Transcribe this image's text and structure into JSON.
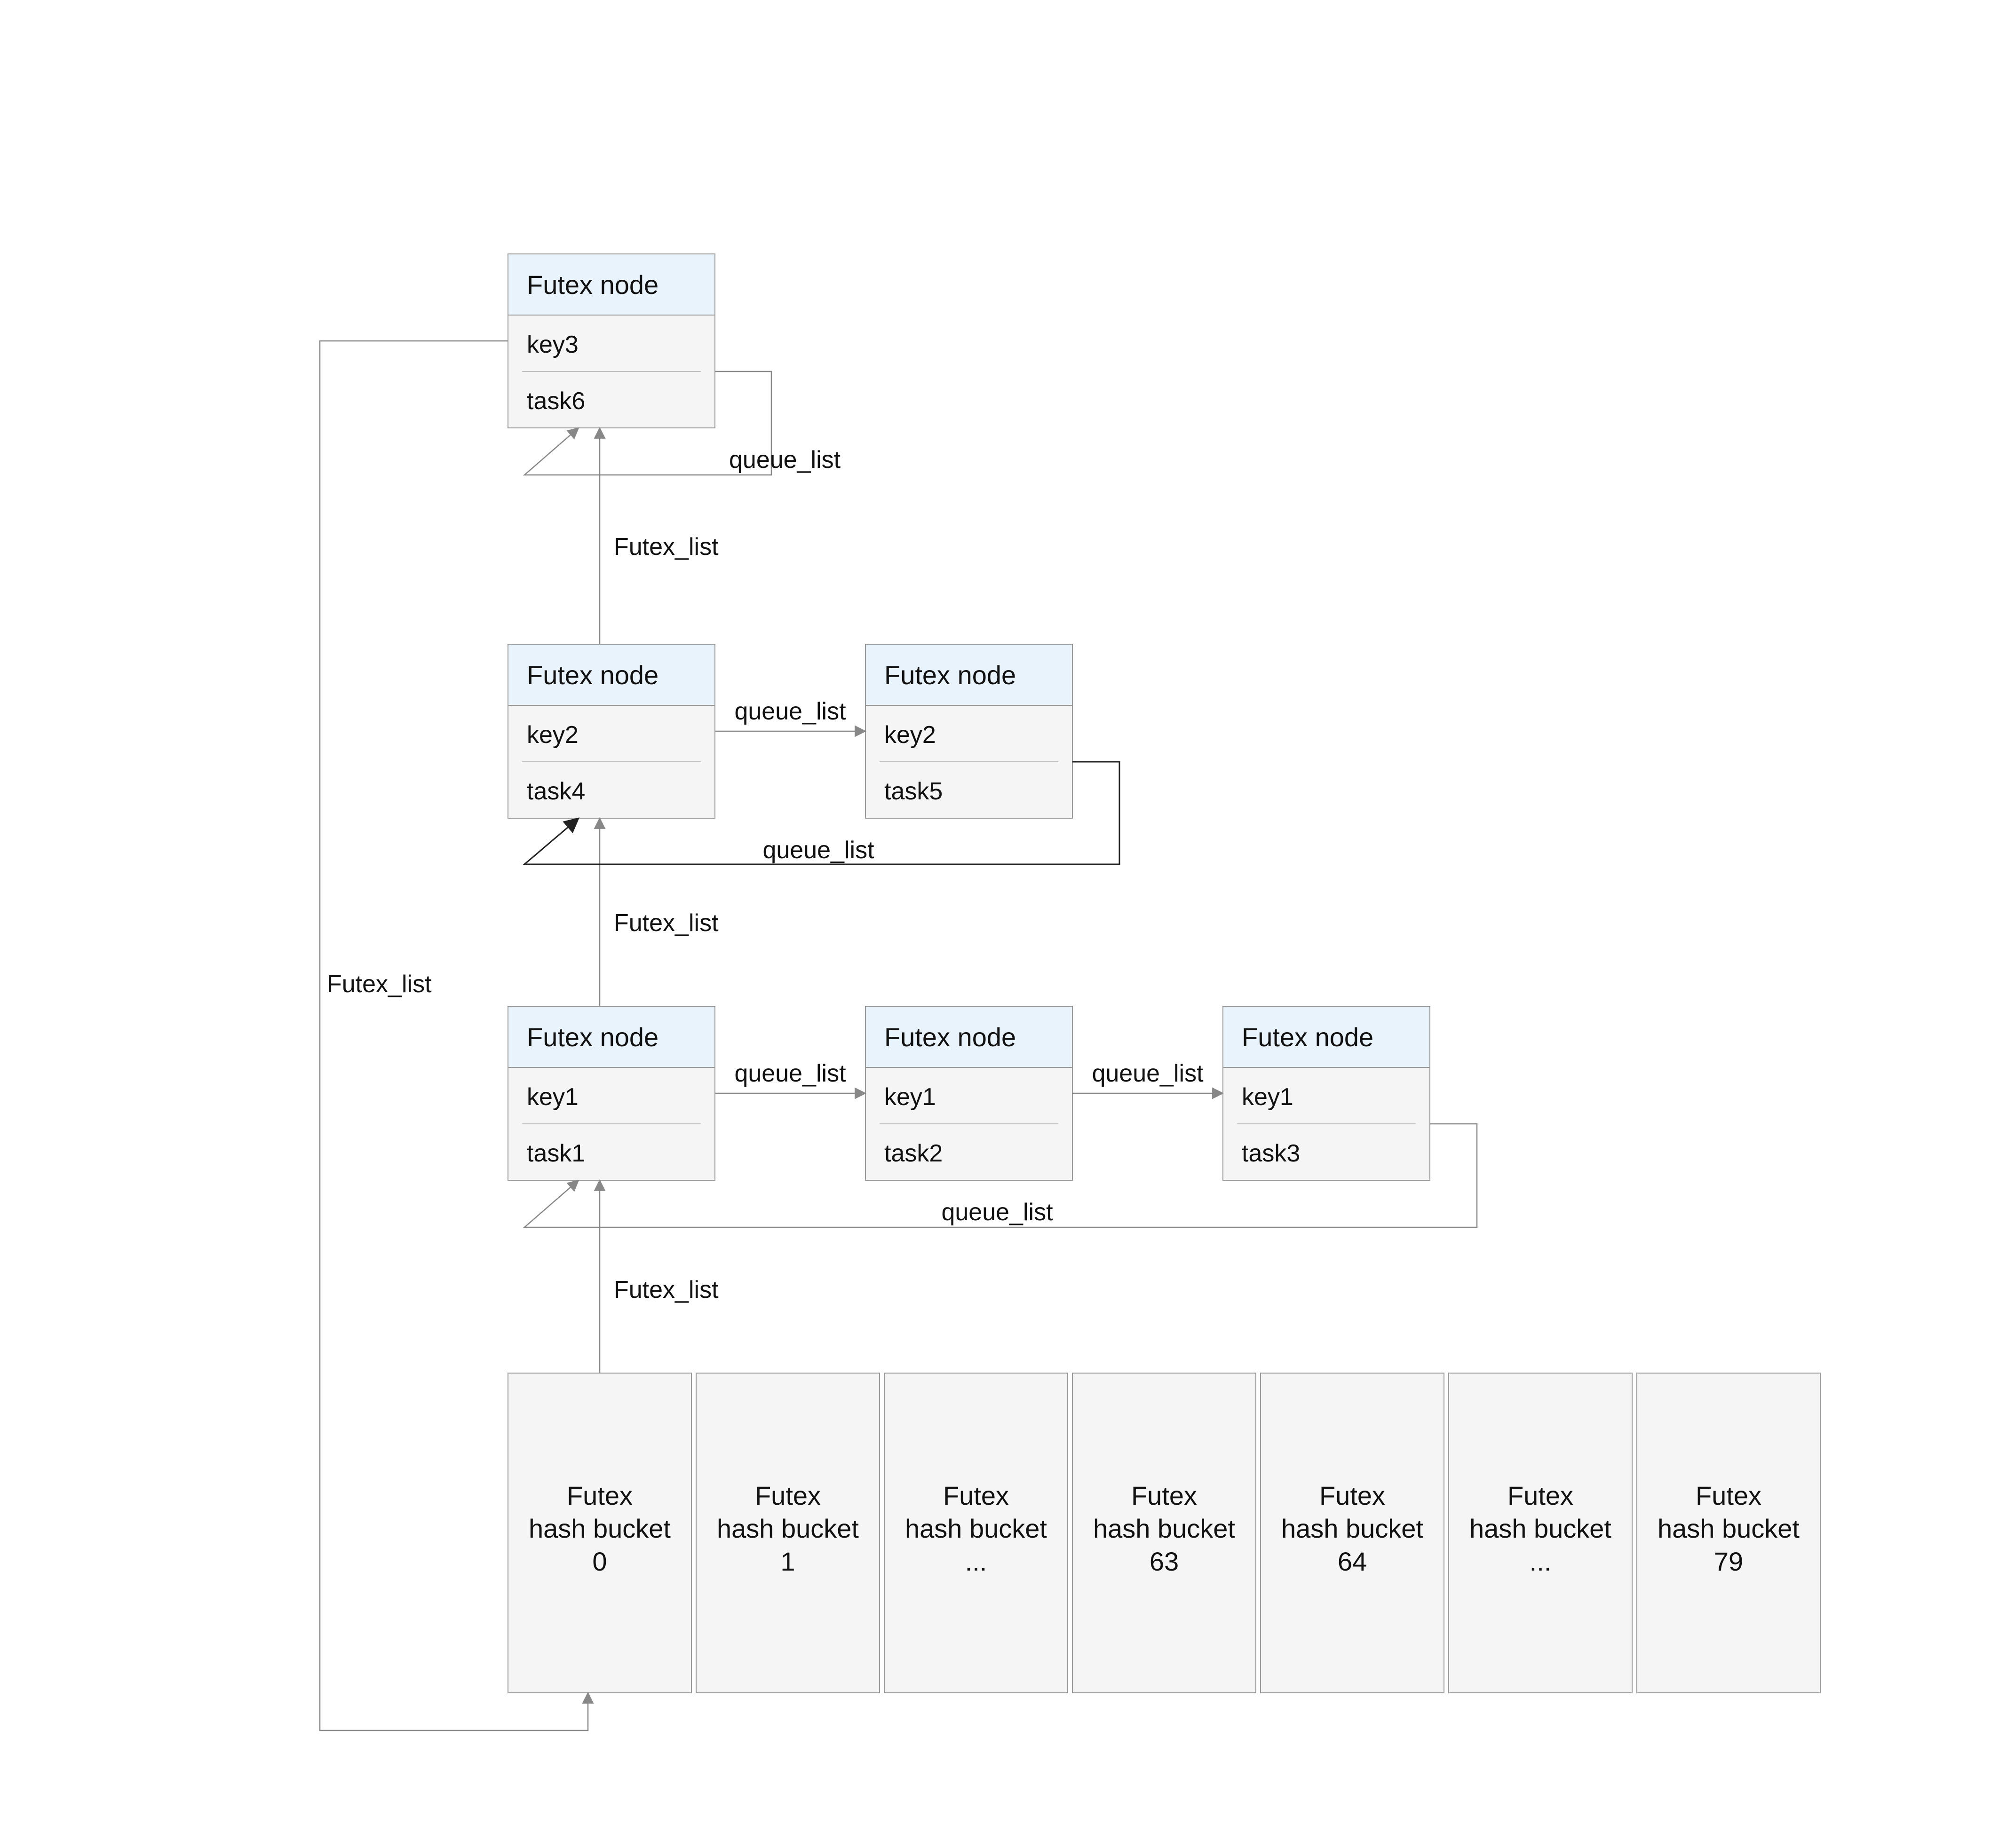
{
  "labels": {
    "futex_node": "Futex node",
    "queue_list": "queue_list",
    "futex_list": "Futex_list",
    "bucket_line1": "Futex",
    "bucket_line2": "hash bucket"
  },
  "buckets": [
    "0",
    "1",
    "...",
    "63",
    "64",
    "...",
    "79"
  ],
  "nodes": {
    "r1c1": {
      "key": "key1",
      "task": "task1"
    },
    "r1c2": {
      "key": "key1",
      "task": "task2"
    },
    "r1c3": {
      "key": "key1",
      "task": "task3"
    },
    "r2c1": {
      "key": "key2",
      "task": "task4"
    },
    "r2c2": {
      "key": "key2",
      "task": "task5"
    },
    "r3c1": {
      "key": "key3",
      "task": "task6"
    }
  }
}
